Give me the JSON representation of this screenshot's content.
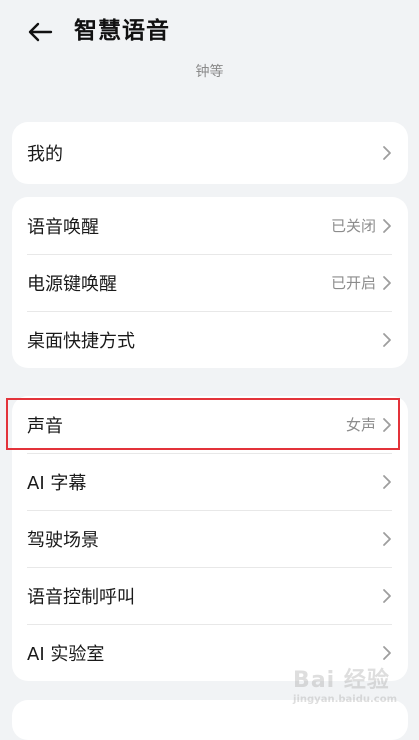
{
  "header": {
    "back_icon": "arrow-left-icon",
    "title": "智慧语音",
    "subtitle": "钟等"
  },
  "groups": [
    {
      "items": [
        {
          "label": "我的",
          "value": ""
        }
      ]
    },
    {
      "items": [
        {
          "label": "语音唤醒",
          "value": "已关闭"
        },
        {
          "label": "电源键唤醒",
          "value": "已开启"
        },
        {
          "label": "桌面快捷方式",
          "value": ""
        }
      ]
    },
    {
      "items": [
        {
          "label": "声音",
          "value": "女声"
        },
        {
          "label": "AI 字幕",
          "value": ""
        },
        {
          "label": "驾驶场景",
          "value": ""
        },
        {
          "label": "语音控制呼叫",
          "value": ""
        },
        {
          "label": "AI 实验室",
          "value": ""
        }
      ]
    }
  ],
  "watermark": {
    "text": "Bai 经验",
    "sub": "jingyan.baidu.com"
  },
  "colors": {
    "background": "#f1f3f5",
    "highlight": "#e3333a"
  }
}
